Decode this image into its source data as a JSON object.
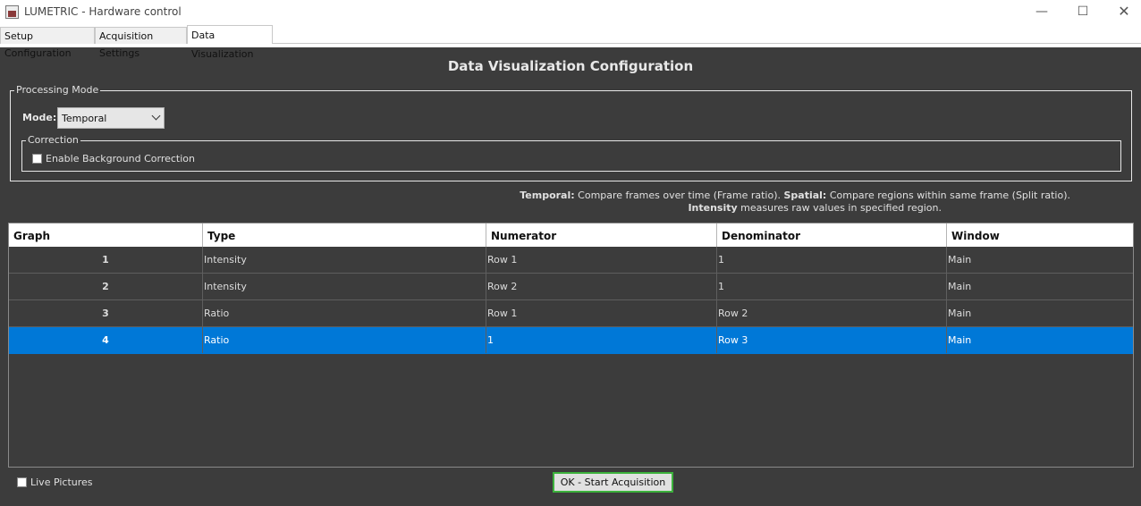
{
  "window": {
    "title": "LUMETRIC - Hardware control",
    "minimize_glyph": "—",
    "maximize_glyph": "☐",
    "close_glyph": "✕"
  },
  "tabs": [
    {
      "label": "Setup Configuration",
      "active": false
    },
    {
      "label": "Acquisition Settings",
      "active": false
    },
    {
      "label": "Data Visualization",
      "active": true
    }
  ],
  "heading": "Data Visualization Configuration",
  "processing_mode": {
    "legend": "Processing Mode",
    "mode_label": "Mode:",
    "mode_value": "Temporal",
    "correction": {
      "legend": "Correction",
      "checkbox_label": "Enable Background Correction",
      "checked": false
    }
  },
  "help": {
    "temporal_key": "Temporal:",
    "temporal_text": " Compare frames over time (Frame ratio). ",
    "spatial_key": "Spatial:",
    "spatial_text": " Compare regions within same frame (Split ratio).",
    "intensity_key": "Intensity",
    "intensity_text": " measures raw values in specified region."
  },
  "table": {
    "columns": [
      "Graph",
      "Type",
      "Numerator",
      "Denominator",
      "Window"
    ],
    "rows": [
      {
        "graph": "1",
        "type": "Intensity",
        "numerator": "Row 1",
        "denominator": "1",
        "window": "Main",
        "selected": false
      },
      {
        "graph": "2",
        "type": "Intensity",
        "numerator": "Row 2",
        "denominator": "1",
        "window": "Main",
        "selected": false
      },
      {
        "graph": "3",
        "type": "Ratio",
        "numerator": "Row 1",
        "denominator": "Row 2",
        "window": "Main",
        "selected": false
      },
      {
        "graph": "4",
        "type": "Ratio",
        "numerator": "1",
        "denominator": "Row 3",
        "window": "Main",
        "selected": true
      }
    ]
  },
  "footer": {
    "live_pictures_label": "Live Pictures",
    "live_pictures_checked": false,
    "ok_button_label": "OK - Start Acquisition"
  },
  "colors": {
    "background": "#3c3c3c",
    "selection": "#0078d7",
    "ok_border": "#3cb13c"
  }
}
